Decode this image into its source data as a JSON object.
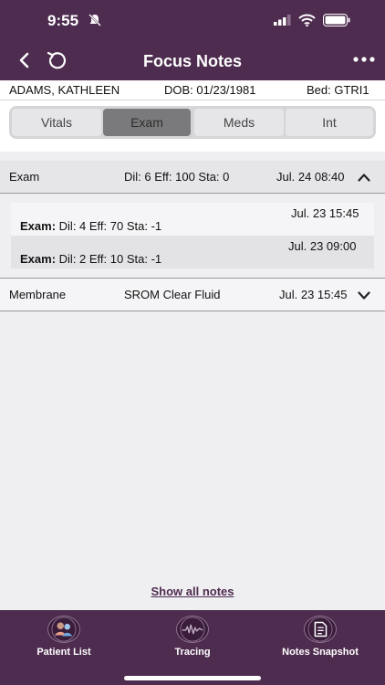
{
  "status": {
    "time": "9:55"
  },
  "nav": {
    "title": "Focus Notes"
  },
  "patient": {
    "name": "ADAMS, KATHLEEN",
    "dob": "DOB: 01/23/1981",
    "bed": "Bed: GTRI1"
  },
  "tabs": {
    "items": [
      {
        "label": "Vitals"
      },
      {
        "label": "Exam"
      },
      {
        "label": "Meds"
      },
      {
        "label": "Int"
      }
    ],
    "selected": "Exam"
  },
  "exam": {
    "label": "Exam",
    "summary": "Dil: 6 Eff: 100 Sta: 0",
    "time": "Jul. 24 08:40",
    "entries": [
      {
        "time": "Jul. 23 15:45",
        "prefix": "Exam:",
        "text": "Dil: 4 Eff: 70 Sta: -1"
      },
      {
        "time": "Jul. 23 09:00",
        "prefix": "Exam:",
        "text": "Dil: 2 Eff: 10 Sta: -1"
      }
    ]
  },
  "membrane": {
    "label": "Membrane",
    "summary": "SROM Clear Fluid",
    "time": "Jul. 23 15:45"
  },
  "show_all": "Show all notes",
  "bottom_tabs": [
    {
      "label": "Patient List",
      "icon": "patient-list-icon"
    },
    {
      "label": "Tracing",
      "icon": "tracing-icon"
    },
    {
      "label": "Notes Snapshot",
      "icon": "notes-snapshot-icon"
    }
  ],
  "colors": {
    "brand": "#4e2c4f",
    "selected_tab": "#7a7a7c",
    "accent_tab_icon": "#e8a08c"
  }
}
